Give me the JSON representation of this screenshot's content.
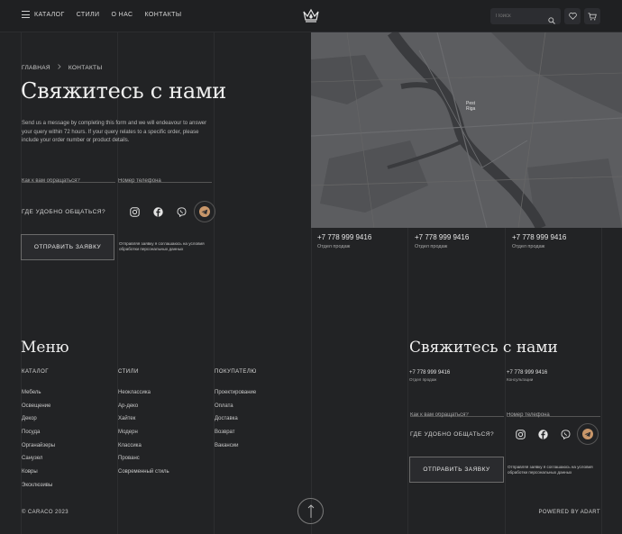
{
  "header": {
    "nav": [
      "КАТАЛОГ",
      "СТИЛИ",
      "О НАС",
      "КОНТАКТЫ"
    ],
    "search_placeholder": "Поиск",
    "icons": [
      "menu-icon",
      "crown-logo",
      "search-icon",
      "heart-icon",
      "cart-icon"
    ]
  },
  "breadcrumb": {
    "home": "ГЛАВНАЯ",
    "current": "КОНТАКТЫ"
  },
  "hero": {
    "title": "Свяжитесь с нами",
    "description": "Send us a message by completing this form and we will endeavour to answer your query within 72 hours. If your query relates to a specific order, please include your order number or product details."
  },
  "form": {
    "name_placeholder": "Как к вам обращаться?",
    "phone_placeholder": "Номер телефона",
    "messenger_label": "ГДЕ УДОБНО ОБЩАТЬСЯ?",
    "socials": [
      "instagram-icon",
      "facebook-icon",
      "viber-icon",
      "telegram-icon"
    ],
    "submit_label": "ОТПРАВИТЬ ЗАЯВКУ",
    "consent": "Отправляя заявку я соглашаюсь на условия обработки персональных данных"
  },
  "map": {
    "city_label_1": "Pest",
    "city_label_2": "Riga",
    "accent_color": "#c9976a"
  },
  "contacts": [
    {
      "phone": "+7 778 999 9416",
      "label": "Отдел продаж"
    },
    {
      "phone": "+7 778 999 9416",
      "label": "Отдел продаж"
    },
    {
      "phone": "+7 778 999 9416",
      "label": "Отдел продаж"
    }
  ],
  "footer": {
    "menu_title": "Меню",
    "columns": [
      {
        "title": "КАТАЛОГ",
        "items": [
          "Мебель",
          "Освещение",
          "Декор",
          "Посуда",
          "Органайзеры",
          "Санузел",
          "Ковры",
          "Эксклюзивы"
        ]
      },
      {
        "title": "СТИЛИ",
        "items": [
          "Неоклассика",
          "Ар-деко",
          "Хайтек",
          "Модерн",
          "Классика",
          "Прованс",
          "Современный стиль"
        ]
      },
      {
        "title": "ПОКУПАТЕЛЮ",
        "items": [
          "Проектирование",
          "Оплата",
          "Доставка",
          "Возврат",
          "Вакансии"
        ]
      }
    ],
    "contact_title": "Свяжитесь с нами",
    "contacts": [
      {
        "phone": "+7 778 999 9416",
        "label": "Отдел продаж"
      },
      {
        "phone": "+7 778 999 9416",
        "label": "Консультации"
      }
    ],
    "copyright": "© CARACO 2023",
    "powered": "POWERED BY ADART"
  }
}
